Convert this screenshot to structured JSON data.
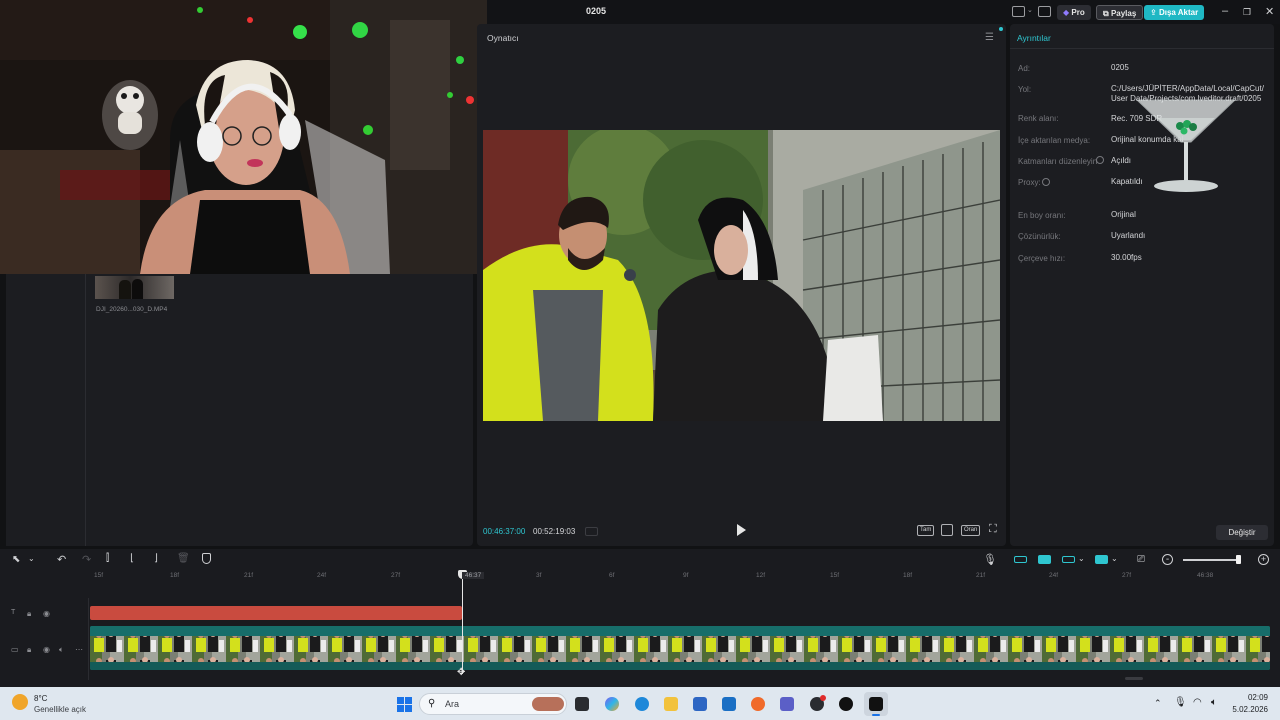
{
  "app": {
    "title": "0205"
  },
  "header": {
    "pro_label": "Pro",
    "share_label": "Paylaş",
    "export_label": "Dışa Aktar"
  },
  "media": {
    "clip_name": "DJI_20260...030_D.MP4"
  },
  "player": {
    "title": "Oynatıcı",
    "current_time": "00:46:37:00",
    "total_time": "00:52:19:03",
    "full_label": "Tam",
    "ratio_label": "Oran"
  },
  "details": {
    "title": "Ayrıntılar",
    "rows": [
      {
        "label": "Ad:",
        "value": "0205"
      },
      {
        "label": "Yol:",
        "value": "C:/Users/JÜPİTER/AppData/Local/CapCut/User Data/Projects/com.lveditor.draft/0205"
      },
      {
        "label": "Renk alanı:",
        "value": "Rec. 709 SDR"
      },
      {
        "label": "İçe aktarılan medya:",
        "value": "Orijinal konumda kal"
      },
      {
        "label": "Katmanları düzenleyin",
        "value": "Açıldı"
      },
      {
        "label": "Proxy:",
        "value": "Kapatıldı"
      },
      {
        "label": "En boy oranı:",
        "value": "Orijinal"
      },
      {
        "label": "Çözünürlük:",
        "value": "Uyarlandı"
      },
      {
        "label": "Çerçeve hızı:",
        "value": "30.00fps"
      }
    ],
    "modify_label": "Değiştir"
  },
  "timeline": {
    "playhead_label": "46:37",
    "ticks": [
      "15f",
      "18f",
      "21f",
      "24f",
      "27f",
      "3f",
      "6f",
      "9f",
      "12f",
      "15f",
      "18f",
      "21f",
      "24f",
      "27f",
      "46:38"
    ]
  },
  "taskbar": {
    "weather_temp": "8°C",
    "weather_desc": "Genellikle açık",
    "search_placeholder": "Ara",
    "time": "02:09",
    "date": "5.02.2026"
  },
  "colors": {
    "accent": "#2fc6d0",
    "export_button": "#1fb8c4",
    "text_clip": "#c94b3f",
    "video_track": "#176e6a"
  }
}
